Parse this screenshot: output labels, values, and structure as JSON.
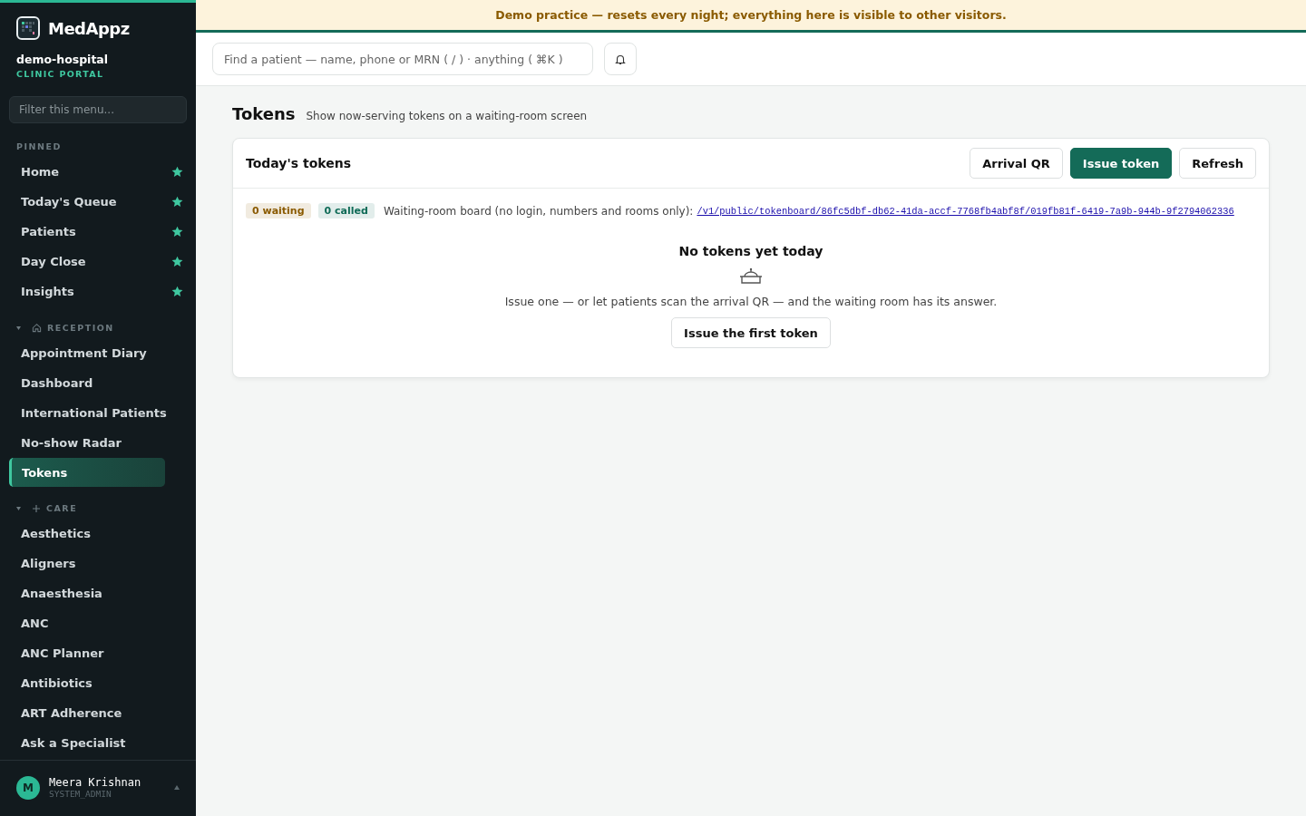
{
  "brand": {
    "name": "MedAppz",
    "org": "demo-hospital",
    "portal": "CLINIC PORTAL"
  },
  "banner": "Demo practice — resets every night; everything here is visible to other visitors.",
  "sidebar": {
    "filter_placeholder": "Filter this menu...",
    "sections": [
      {
        "title": "PINNED",
        "kind": "pinned",
        "items": [
          {
            "label": "Home",
            "selected": false,
            "pinned": true
          },
          {
            "label": "Today's Queue",
            "selected": false,
            "pinned": true
          },
          {
            "label": "Patients",
            "selected": false,
            "pinned": true
          },
          {
            "label": "Day Close",
            "selected": false,
            "pinned": true
          },
          {
            "label": "Insights",
            "selected": false,
            "pinned": true
          }
        ]
      },
      {
        "title": "RECEPTION",
        "kind": "reception",
        "items": [
          {
            "label": "Appointment Diary",
            "selected": false,
            "pinned": false
          },
          {
            "label": "Dashboard",
            "selected": false,
            "pinned": false
          },
          {
            "label": "International Patients",
            "selected": false,
            "pinned": false
          },
          {
            "label": "No-show Radar",
            "selected": false,
            "pinned": false
          },
          {
            "label": "Tokens",
            "selected": true,
            "pinned": false
          }
        ]
      },
      {
        "title": "CARE",
        "kind": "care",
        "items": [
          {
            "label": "Aesthetics",
            "selected": false,
            "pinned": false
          },
          {
            "label": "Aligners",
            "selected": false,
            "pinned": false
          },
          {
            "label": "Anaesthesia",
            "selected": false,
            "pinned": false
          },
          {
            "label": "ANC",
            "selected": false,
            "pinned": false
          },
          {
            "label": "ANC Planner",
            "selected": false,
            "pinned": false
          },
          {
            "label": "Antibiotics",
            "selected": false,
            "pinned": false
          },
          {
            "label": "ART Adherence",
            "selected": false,
            "pinned": false
          },
          {
            "label": "Ask a Specialist",
            "selected": false,
            "pinned": false
          }
        ]
      }
    ],
    "user": {
      "initial": "M",
      "name": "Meera Krishnan",
      "role": "SYSTEM_ADMIN"
    }
  },
  "search": {
    "placeholder": "Find a patient — name, phone or MRN ( / ) · anything ( ⌘K )"
  },
  "page": {
    "title": "Tokens",
    "subtitle": "Show now-serving tokens on a waiting-room screen"
  },
  "card": {
    "title": "Today's tokens",
    "buttons": [
      {
        "label": "Arrival QR",
        "kind": "secondary"
      },
      {
        "label": "Issue token",
        "kind": "primary"
      },
      {
        "label": "Refresh",
        "kind": "secondary"
      }
    ],
    "badges": [
      {
        "label": "0 waiting",
        "color": "#8a5a00"
      },
      {
        "label": "0 called",
        "color": "#0f6b57"
      }
    ],
    "board_text": "Waiting-room board (no login, numbers and rooms only):",
    "board_link": "/v1/public/tokenboard/86fc5dbf-db62-41da-accf-7768fb4abf8f/019fb81f-6419-7a9b-944b-9f2794062336",
    "empty": {
      "title": "No tokens yet today",
      "text": "Issue one — or let patients scan the arrival QR — and the waiting room has its answer.",
      "button": "Issue the first token"
    }
  }
}
